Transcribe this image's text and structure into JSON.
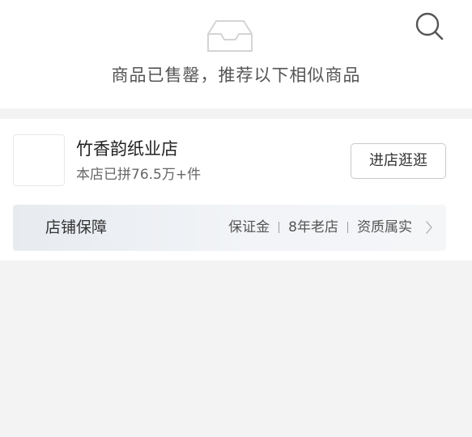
{
  "soldout": {
    "message": "商品已售罄，推荐以下相似商品"
  },
  "store": {
    "name": "竹香韵纸业店",
    "sales": "本店已拼76.5万+件",
    "visit_label": "进店逛逛"
  },
  "guarantee": {
    "title": "店铺保障",
    "items": [
      "保证金",
      "8年老店",
      "资质属实"
    ]
  },
  "icons": {
    "search": "search-icon",
    "empty_box": "empty-box-icon",
    "chevron": "chevron-right-icon"
  },
  "colors": {
    "page_background": "#f3f3f3",
    "card_background": "#ffffff",
    "guarantee_background": "#eef1f4",
    "primary_text": "#333333",
    "secondary_text": "#666666"
  }
}
